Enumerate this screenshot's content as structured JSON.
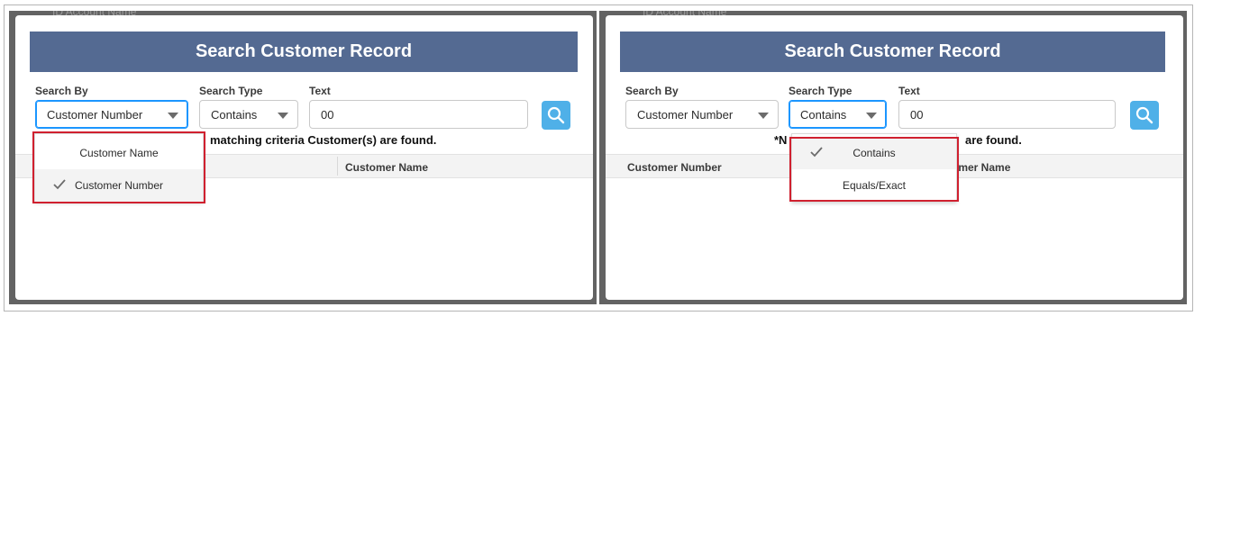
{
  "background_label": "ID Account Name",
  "colors": {
    "header_bg": "#546a92",
    "search_button": "#4fb0e8",
    "highlight_border": "#d0202f",
    "overlay": "#636363"
  },
  "panels": [
    {
      "title": "Search Customer Record",
      "search_by_label": "Search By",
      "search_by_value": "Customer Number",
      "search_type_label": "Search Type",
      "search_type_value": "Contains",
      "text_label": "Text",
      "text_value": "00",
      "status_message": "matching criteria Customer(s) are found.",
      "columns": [
        "Customer Name"
      ],
      "open_dropdown": "search_by",
      "dropdown_items": [
        {
          "label": "Customer Name",
          "selected": false
        },
        {
          "label": "Customer Number",
          "selected": true
        }
      ]
    },
    {
      "title": "Search Customer Record",
      "search_by_label": "Search By",
      "search_by_value": "Customer Number",
      "search_type_label": "Search Type",
      "search_type_value": "Contains",
      "text_label": "Text",
      "text_value": "00",
      "status_prefix": "*N",
      "status_suffix": "are found.",
      "columns": [
        "Customer Number",
        "omer Name"
      ],
      "open_dropdown": "search_type",
      "dropdown_items": [
        {
          "label": "Contains",
          "selected": true
        },
        {
          "label": "Equals/Exact",
          "selected": false
        }
      ]
    }
  ]
}
